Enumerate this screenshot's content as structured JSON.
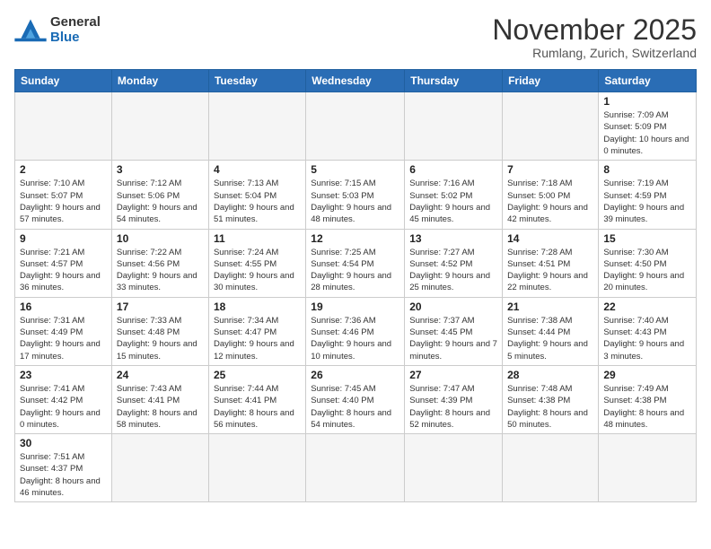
{
  "logo": {
    "line1": "General",
    "line2": "Blue"
  },
  "title": "November 2025",
  "subtitle": "Rumlang, Zurich, Switzerland",
  "weekdays": [
    "Sunday",
    "Monday",
    "Tuesday",
    "Wednesday",
    "Thursday",
    "Friday",
    "Saturday"
  ],
  "weeks": [
    [
      {
        "day": "",
        "info": ""
      },
      {
        "day": "",
        "info": ""
      },
      {
        "day": "",
        "info": ""
      },
      {
        "day": "",
        "info": ""
      },
      {
        "day": "",
        "info": ""
      },
      {
        "day": "",
        "info": ""
      },
      {
        "day": "1",
        "info": "Sunrise: 7:09 AM\nSunset: 5:09 PM\nDaylight: 10 hours and 0 minutes."
      }
    ],
    [
      {
        "day": "2",
        "info": "Sunrise: 7:10 AM\nSunset: 5:07 PM\nDaylight: 9 hours and 57 minutes."
      },
      {
        "day": "3",
        "info": "Sunrise: 7:12 AM\nSunset: 5:06 PM\nDaylight: 9 hours and 54 minutes."
      },
      {
        "day": "4",
        "info": "Sunrise: 7:13 AM\nSunset: 5:04 PM\nDaylight: 9 hours and 51 minutes."
      },
      {
        "day": "5",
        "info": "Sunrise: 7:15 AM\nSunset: 5:03 PM\nDaylight: 9 hours and 48 minutes."
      },
      {
        "day": "6",
        "info": "Sunrise: 7:16 AM\nSunset: 5:02 PM\nDaylight: 9 hours and 45 minutes."
      },
      {
        "day": "7",
        "info": "Sunrise: 7:18 AM\nSunset: 5:00 PM\nDaylight: 9 hours and 42 minutes."
      },
      {
        "day": "8",
        "info": "Sunrise: 7:19 AM\nSunset: 4:59 PM\nDaylight: 9 hours and 39 minutes."
      }
    ],
    [
      {
        "day": "9",
        "info": "Sunrise: 7:21 AM\nSunset: 4:57 PM\nDaylight: 9 hours and 36 minutes."
      },
      {
        "day": "10",
        "info": "Sunrise: 7:22 AM\nSunset: 4:56 PM\nDaylight: 9 hours and 33 minutes."
      },
      {
        "day": "11",
        "info": "Sunrise: 7:24 AM\nSunset: 4:55 PM\nDaylight: 9 hours and 30 minutes."
      },
      {
        "day": "12",
        "info": "Sunrise: 7:25 AM\nSunset: 4:54 PM\nDaylight: 9 hours and 28 minutes."
      },
      {
        "day": "13",
        "info": "Sunrise: 7:27 AM\nSunset: 4:52 PM\nDaylight: 9 hours and 25 minutes."
      },
      {
        "day": "14",
        "info": "Sunrise: 7:28 AM\nSunset: 4:51 PM\nDaylight: 9 hours and 22 minutes."
      },
      {
        "day": "15",
        "info": "Sunrise: 7:30 AM\nSunset: 4:50 PM\nDaylight: 9 hours and 20 minutes."
      }
    ],
    [
      {
        "day": "16",
        "info": "Sunrise: 7:31 AM\nSunset: 4:49 PM\nDaylight: 9 hours and 17 minutes."
      },
      {
        "day": "17",
        "info": "Sunrise: 7:33 AM\nSunset: 4:48 PM\nDaylight: 9 hours and 15 minutes."
      },
      {
        "day": "18",
        "info": "Sunrise: 7:34 AM\nSunset: 4:47 PM\nDaylight: 9 hours and 12 minutes."
      },
      {
        "day": "19",
        "info": "Sunrise: 7:36 AM\nSunset: 4:46 PM\nDaylight: 9 hours and 10 minutes."
      },
      {
        "day": "20",
        "info": "Sunrise: 7:37 AM\nSunset: 4:45 PM\nDaylight: 9 hours and 7 minutes."
      },
      {
        "day": "21",
        "info": "Sunrise: 7:38 AM\nSunset: 4:44 PM\nDaylight: 9 hours and 5 minutes."
      },
      {
        "day": "22",
        "info": "Sunrise: 7:40 AM\nSunset: 4:43 PM\nDaylight: 9 hours and 3 minutes."
      }
    ],
    [
      {
        "day": "23",
        "info": "Sunrise: 7:41 AM\nSunset: 4:42 PM\nDaylight: 9 hours and 0 minutes."
      },
      {
        "day": "24",
        "info": "Sunrise: 7:43 AM\nSunset: 4:41 PM\nDaylight: 8 hours and 58 minutes."
      },
      {
        "day": "25",
        "info": "Sunrise: 7:44 AM\nSunset: 4:41 PM\nDaylight: 8 hours and 56 minutes."
      },
      {
        "day": "26",
        "info": "Sunrise: 7:45 AM\nSunset: 4:40 PM\nDaylight: 8 hours and 54 minutes."
      },
      {
        "day": "27",
        "info": "Sunrise: 7:47 AM\nSunset: 4:39 PM\nDaylight: 8 hours and 52 minutes."
      },
      {
        "day": "28",
        "info": "Sunrise: 7:48 AM\nSunset: 4:38 PM\nDaylight: 8 hours and 50 minutes."
      },
      {
        "day": "29",
        "info": "Sunrise: 7:49 AM\nSunset: 4:38 PM\nDaylight: 8 hours and 48 minutes."
      }
    ],
    [
      {
        "day": "30",
        "info": "Sunrise: 7:51 AM\nSunset: 4:37 PM\nDaylight: 8 hours and 46 minutes."
      },
      {
        "day": "",
        "info": ""
      },
      {
        "day": "",
        "info": ""
      },
      {
        "day": "",
        "info": ""
      },
      {
        "day": "",
        "info": ""
      },
      {
        "day": "",
        "info": ""
      },
      {
        "day": "",
        "info": ""
      }
    ]
  ]
}
